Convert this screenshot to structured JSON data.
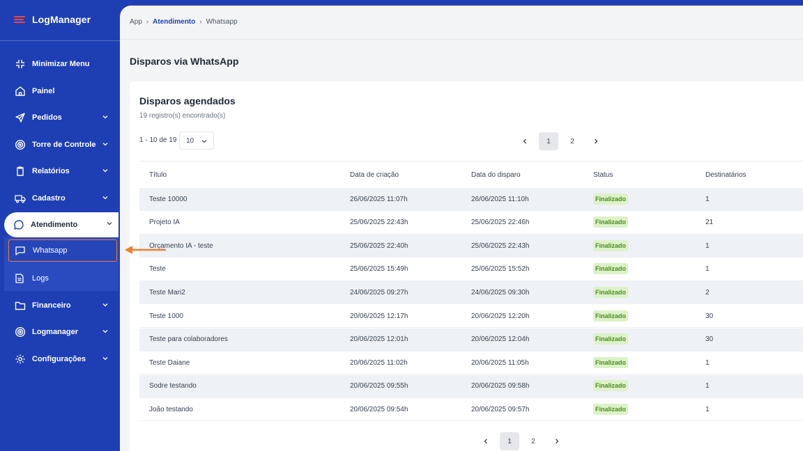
{
  "app": {
    "name": "LogManager"
  },
  "colors": {
    "brand": "#1e3fb4",
    "accent": "#f47c2a",
    "status_ok_bg": "#dcf2c8",
    "status_ok_text": "#4d8a1f",
    "logo": "#e5484d"
  },
  "sidebar": {
    "items": [
      {
        "label": "Minimizar Menu",
        "icon": "minimize-icon"
      },
      {
        "label": "Painel",
        "icon": "home-icon"
      },
      {
        "label": "Pedidos",
        "icon": "send-icon"
      },
      {
        "label": "Torre de Controle",
        "icon": "target-icon"
      },
      {
        "label": "Relatórios",
        "icon": "clipboard-icon"
      },
      {
        "label": "Cadastro",
        "icon": "truck-icon"
      },
      {
        "label": "Atendimento",
        "icon": "chat-icon"
      },
      {
        "label": "Financeiro",
        "icon": "folder-icon"
      },
      {
        "label": "Logmanager",
        "icon": "target-icon"
      },
      {
        "label": "Configurações",
        "icon": "gear-icon"
      }
    ],
    "submenu": [
      {
        "label": "Whatsapp",
        "icon": "message-square-icon"
      },
      {
        "label": "Logs",
        "icon": "file-icon"
      }
    ]
  },
  "breadcrumb": {
    "root": "App",
    "section": "Atendimento",
    "page": "Whatsapp"
  },
  "page": {
    "title": "Disparos via WhatsApp"
  },
  "card": {
    "title": "Disparos agendados",
    "subtitle": "19 registro(s) encontrado(s)",
    "range": "1 - 10 de 19",
    "page_size": "10",
    "pages": [
      "1",
      "2"
    ],
    "current_page": "1"
  },
  "table": {
    "headers": [
      "Título",
      "Data de criação",
      "Data do disparo",
      "Status",
      "Destinatários"
    ],
    "rows": [
      {
        "title": "Teste 10000",
        "created": "26/06/2025 11:07h",
        "sent": "26/06/2025 11:10h",
        "status": "Finalizado",
        "recipients": "1"
      },
      {
        "title": "Projeto IA",
        "created": "25/06/2025 22:43h",
        "sent": "25/06/2025 22:46h",
        "status": "Finalizado",
        "recipients": "21"
      },
      {
        "title": "Orçamento IA - teste",
        "created": "25/06/2025 22:40h",
        "sent": "25/06/2025 22:43h",
        "status": "Finalizado",
        "recipients": "1"
      },
      {
        "title": "Teste",
        "created": "25/06/2025 15:49h",
        "sent": "25/06/2025 15:52h",
        "status": "Finalizado",
        "recipients": "1"
      },
      {
        "title": "Teste Mari2",
        "created": "24/06/2025 09:27h",
        "sent": "24/06/2025 09:30h",
        "status": "Finalizado",
        "recipients": "2"
      },
      {
        "title": "Teste 1000",
        "created": "20/06/2025 12:17h",
        "sent": "20/06/2025 12:20h",
        "status": "Finalizado",
        "recipients": "30"
      },
      {
        "title": "Teste para colaboradores",
        "created": "20/06/2025 12:01h",
        "sent": "20/06/2025 12:04h",
        "status": "Finalizado",
        "recipients": "30"
      },
      {
        "title": "Teste Daiane",
        "created": "20/06/2025 11:02h",
        "sent": "20/06/2025 11:05h",
        "status": "Finalizado",
        "recipients": "1"
      },
      {
        "title": "Sodre testando",
        "created": "20/06/2025 09:55h",
        "sent": "20/06/2025 09:58h",
        "status": "Finalizado",
        "recipients": "1"
      },
      {
        "title": "João testando",
        "created": "20/06/2025 09:54h",
        "sent": "20/06/2025 09:57h",
        "status": "Finalizado",
        "recipients": "1"
      }
    ]
  }
}
